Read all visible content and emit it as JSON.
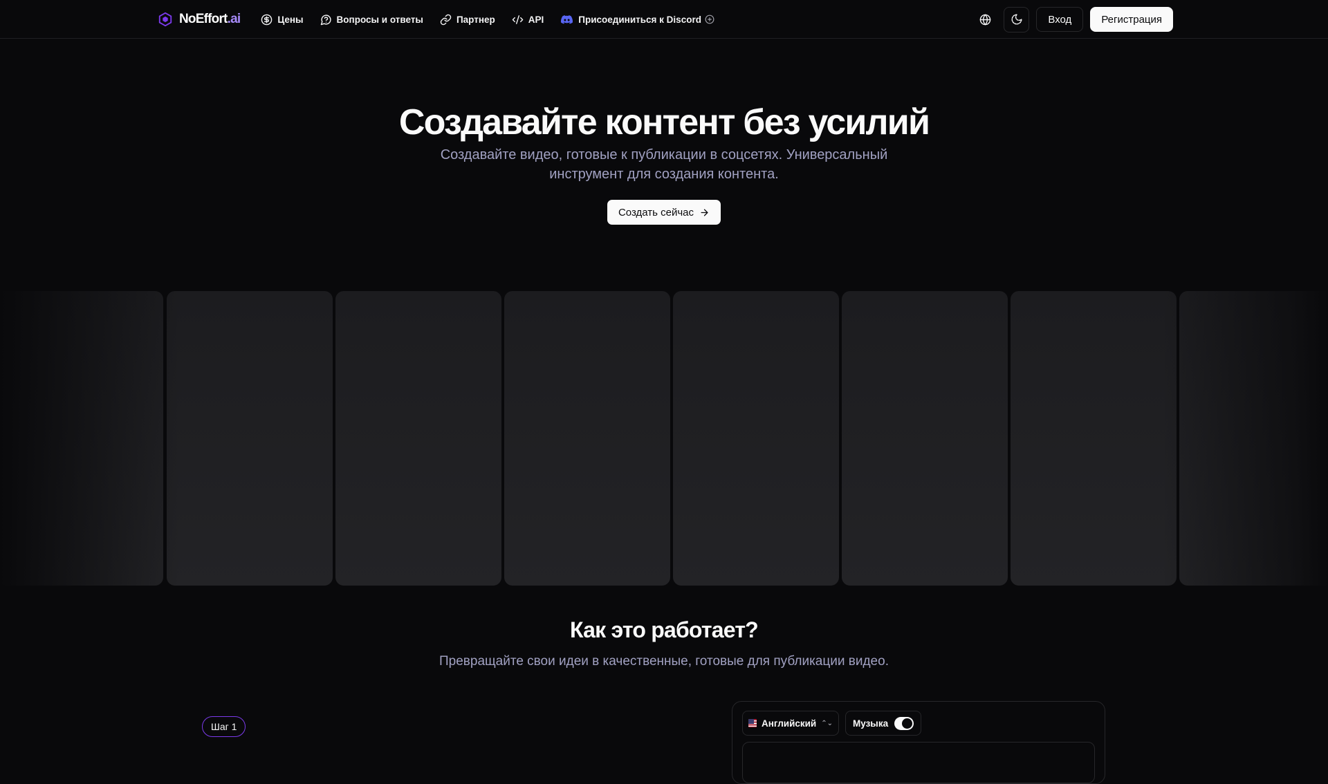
{
  "header": {
    "logo": {
      "name": "NoEffort",
      "suffix": ".ai",
      "icon": "hexagon-logo-icon"
    },
    "nav": [
      {
        "label": "Цены",
        "icon": "dollar-circle-icon"
      },
      {
        "label": "Вопросы и ответы",
        "icon": "message-circle-question-icon"
      },
      {
        "label": "Партнер",
        "icon": "link-icon"
      },
      {
        "label": "API",
        "icon": "code-icon"
      },
      {
        "label": "Присоединиться к Discord",
        "icon": "discord-icon"
      }
    ],
    "login_label": "Вход",
    "register_label": "Регистрация"
  },
  "hero": {
    "title": "Создавайте контент без усилий",
    "subtitle": "Создавайте видео, готовые к публикации в соцсетях. Универсальный инструмент для создания контента.",
    "cta_label": "Создать сейчас"
  },
  "how": {
    "title": "Как это работает?",
    "subtitle": "Превращайте свои идеи в качественные, готовые для публикации видео.",
    "step_label": "Шаг 1",
    "language_label": "Английский",
    "music_label": "Музыка",
    "music_on": true
  },
  "colors": {
    "background": "#09090b",
    "accent": "#7c3aed",
    "logo_accent": "#a78bfa",
    "muted_text": "#a1a1c2"
  }
}
